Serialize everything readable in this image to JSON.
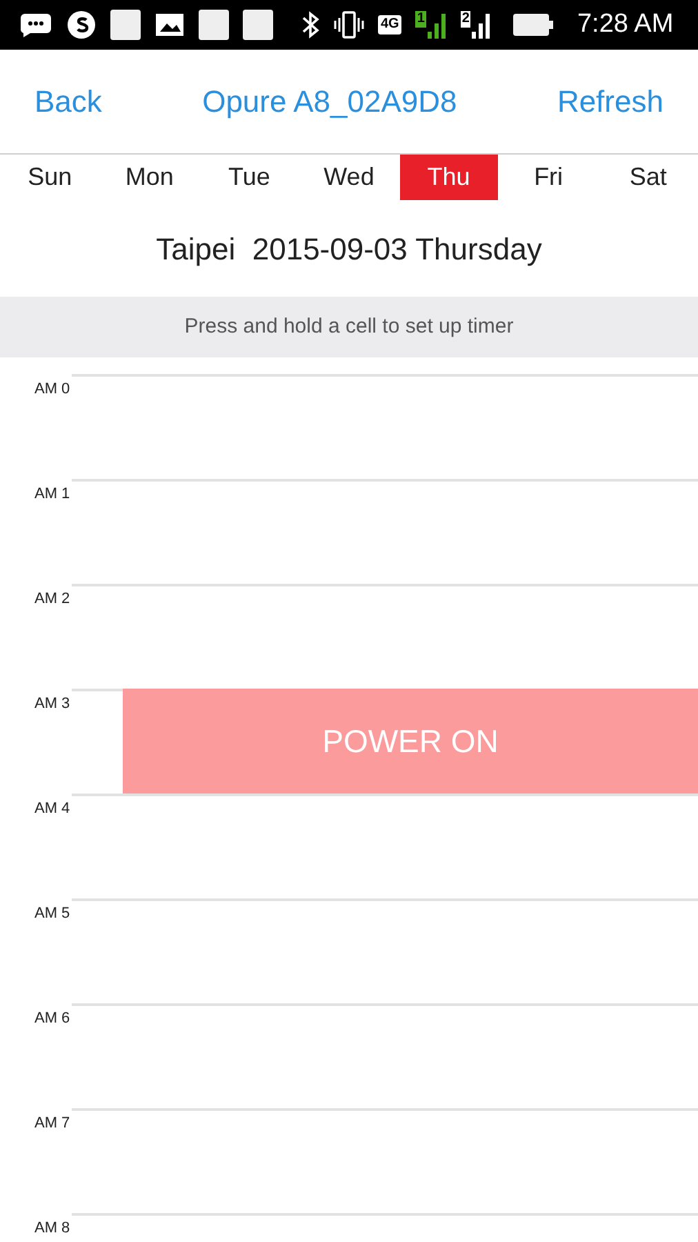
{
  "status_bar": {
    "network": "4G",
    "sims": [
      "1",
      "2"
    ],
    "time": "7:28 AM"
  },
  "nav": {
    "back": "Back",
    "title": "Opure A8_02A9D8",
    "refresh": "Refresh"
  },
  "days": [
    {
      "label": "Sun",
      "selected": false
    },
    {
      "label": "Mon",
      "selected": false
    },
    {
      "label": "Tue",
      "selected": false
    },
    {
      "label": "Wed",
      "selected": false
    },
    {
      "label": "Thu",
      "selected": true
    },
    {
      "label": "Fri",
      "selected": false
    },
    {
      "label": "Sat",
      "selected": false
    }
  ],
  "date_line": "Taipei  2015-09-03 Thursday",
  "hint": "Press and hold a cell to set up timer",
  "hours": [
    {
      "label": "AM 0"
    },
    {
      "label": "AM 1"
    },
    {
      "label": "AM 2"
    },
    {
      "label": "AM 3",
      "event": {
        "label": "POWER ON"
      }
    },
    {
      "label": "AM 4"
    },
    {
      "label": "AM 5"
    },
    {
      "label": "AM 6"
    },
    {
      "label": "AM 7"
    },
    {
      "label": "AM 8"
    }
  ]
}
